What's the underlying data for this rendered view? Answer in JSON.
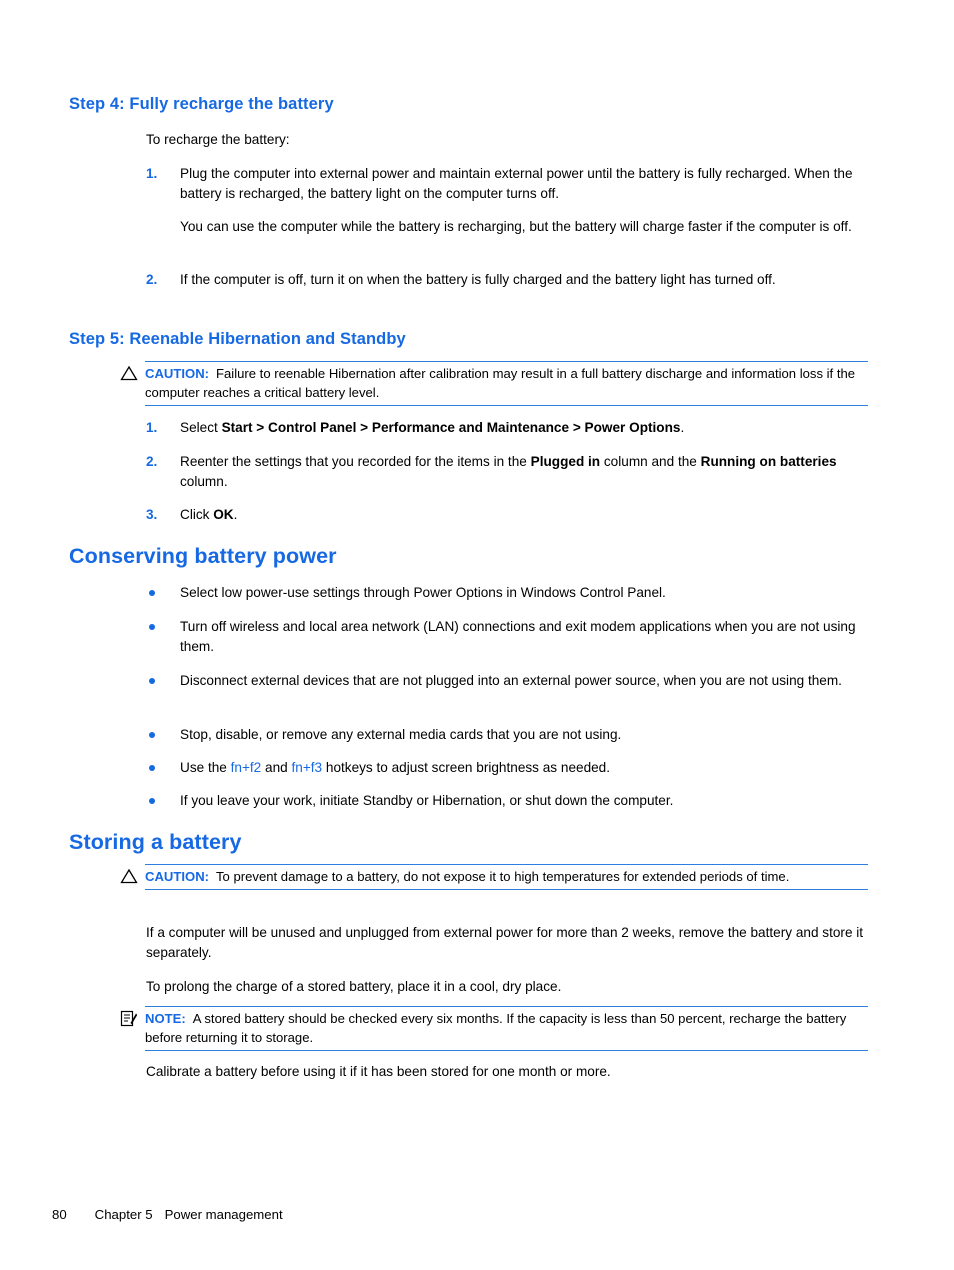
{
  "colors": {
    "heading_blue": "#1669e3",
    "rule_blue": "#2b7fe0",
    "body_black": "#000000"
  },
  "sections": {
    "step4": {
      "heading": "Step 4: Fully recharge the battery",
      "intro": "To recharge the battery:",
      "items": [
        {
          "marker": "1.",
          "text": "Plug the computer into external power and maintain external power until the battery is fully recharged. When the battery is recharged, the battery light on the computer turns off."
        },
        {
          "marker": "2.",
          "text": "If the computer is off, turn it on when the battery is fully charged and the battery light has turned off."
        }
      ],
      "sub_paragraph": "You can use the computer while the battery is recharging, but the battery will charge faster if the computer is off."
    },
    "step5": {
      "heading": "Step 5: Reenable Hibernation and Standby",
      "caution": {
        "icon": "warning-triangle-icon",
        "label": "CAUTION:",
        "text": "Failure to reenable Hibernation after calibration may result in a full battery discharge and information loss if the computer reaches a critical battery level."
      },
      "items": [
        {
          "marker": "1.",
          "prefix": "Select ",
          "bold": "Start > Control Panel > Performance and Maintenance > Power Options",
          "suffix": "."
        },
        {
          "marker": "2.",
          "prefix": "Reenter the settings that you recorded for the items in the ",
          "bold": "Plugged in",
          "middle": " column and the ",
          "bold2": "Running on batteries",
          "suffix": " column."
        },
        {
          "marker": "3.",
          "prefix": "Click ",
          "bold": "OK",
          "suffix": "."
        }
      ]
    },
    "conserving": {
      "heading": "Conserving battery power",
      "bullets": [
        {
          "text": "Select low power-use settings through Power Options in Windows Control Panel."
        },
        {
          "text": "Turn off wireless and local area network (LAN) connections and exit modem applications when you are not using them."
        },
        {
          "text": "Disconnect external devices that are not plugged into an external power source, when you are not using them."
        },
        {
          "text": "Stop, disable, or remove any external media cards that you are not using."
        },
        {
          "prefix": "Use the ",
          "link1": "fn+f2",
          "middle": " and ",
          "link2": "fn+f3",
          "suffix": " hotkeys to adjust screen brightness as needed."
        },
        {
          "text": "If you leave your work, initiate Standby or Hibernation, or shut down the computer."
        }
      ]
    },
    "storing": {
      "heading": "Storing a battery",
      "caution": {
        "icon": "warning-triangle-icon",
        "label": "CAUTION:",
        "text": "To prevent damage to a battery, do not expose it to high temperatures for extended periods of time."
      },
      "paragraph1": "If a computer will be unused and unplugged from external power for more than 2 weeks, remove the battery and store it separately.",
      "paragraph2": "To prolong the charge of a stored battery, place it in a cool, dry place.",
      "note": {
        "icon": "note-clipboard-icon",
        "label": "NOTE:",
        "text": "A stored battery should be checked every six months. If the capacity is less than 50 percent, recharge the battery before returning it to storage."
      },
      "paragraph3": "Calibrate a battery before using it if it has been stored for one month or more."
    }
  },
  "footer": {
    "page_number": "80",
    "chapter": "Chapter 5",
    "chapter_title": "Power management"
  }
}
